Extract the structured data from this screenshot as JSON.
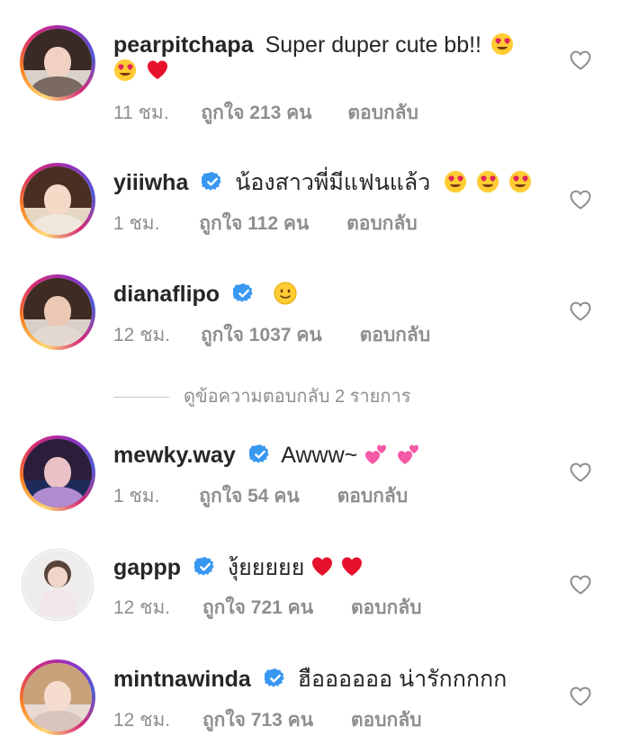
{
  "comments": [
    {
      "username": "pearpitchapa",
      "verified": false,
      "text": "Super duper cute bb!!",
      "emojis_line1": [
        "heart-eyes"
      ],
      "emojis_line2": [
        "heart-eyes",
        "red-heart"
      ],
      "time": "11 ชม.",
      "likes": "ถูกใจ 213 คน",
      "reply": "ตอบกลับ"
    },
    {
      "username": "yiiiwha",
      "verified": true,
      "text": "น้องสาวพี่มีแฟนแล้ว",
      "emojis_line1": [
        "heart-eyes",
        "heart-eyes",
        "heart-eyes"
      ],
      "time": "1 ชม.",
      "likes": "ถูกใจ 112 คน",
      "reply": "ตอบกลับ"
    },
    {
      "username": "dianaflipo",
      "verified": true,
      "text": "",
      "emojis_line1": [
        "slight-smile"
      ],
      "time": "12 ชม.",
      "likes": "ถูกใจ 1037 คน",
      "reply": "ตอบกลับ"
    },
    {
      "username": "mewky.way",
      "verified": true,
      "text": "Awww~",
      "emojis_line1": [
        "two-hearts",
        "two-hearts"
      ],
      "time": "1 ชม.",
      "likes": "ถูกใจ 54 คน",
      "reply": "ตอบกลับ"
    },
    {
      "username": "gappp",
      "verified": true,
      "text": "งุ้ยยยยย",
      "emojis_line1": [
        "red-heart",
        "red-heart"
      ],
      "time": "12 ชม.",
      "likes": "ถูกใจ 721 คน",
      "reply": "ตอบกลับ"
    },
    {
      "username": "mintnawinda",
      "verified": true,
      "text": "ฮืออออออ น่ารักกกกก",
      "emojis_line1": [],
      "time": "12 ชม.",
      "likes": "ถูกใจ 713 คน",
      "reply": "ตอบกลับ"
    }
  ],
  "view_replies": "ดูข้อความตอบกลับ 2 รายการ",
  "colors": {
    "text": "#262626",
    "meta": "#8e8e8e",
    "verified": "#3897f0",
    "heart": "#ed4956"
  }
}
